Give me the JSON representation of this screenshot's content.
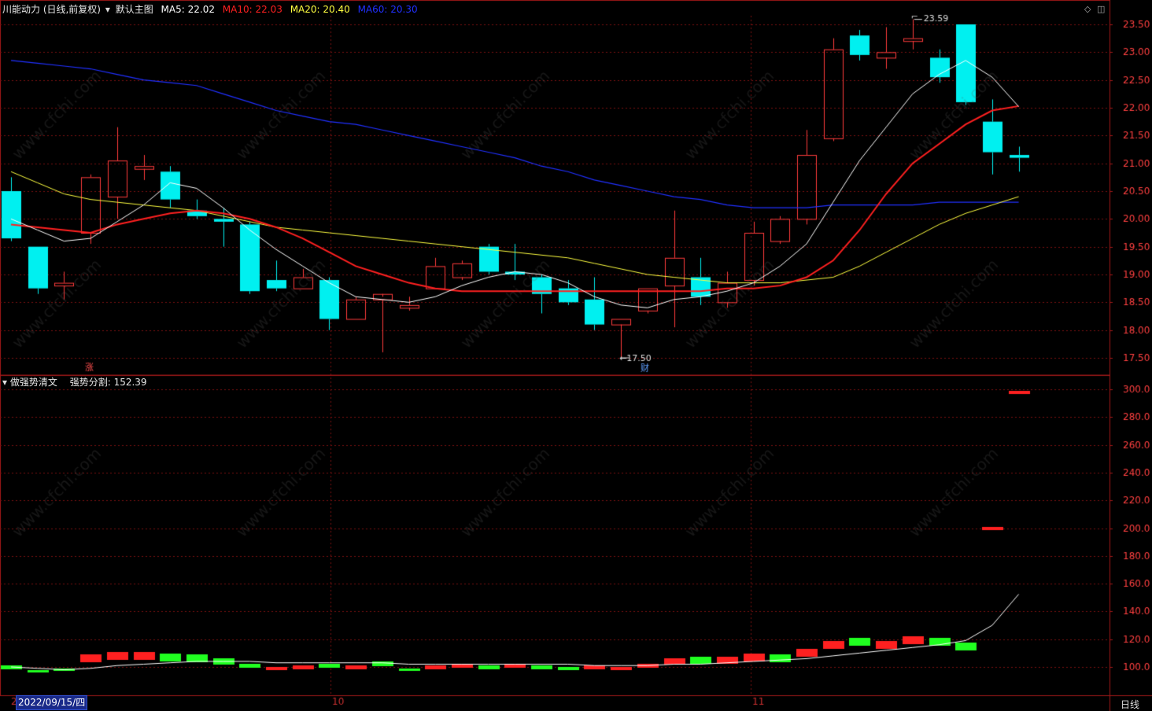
{
  "header": {
    "stock_title": "川能动力 (日线,前复权)",
    "main_chart_label": "默认主图",
    "ma5": {
      "label": "MA5:",
      "value": "22.02",
      "color": "#ffffff"
    },
    "ma10": {
      "label": "MA10:",
      "value": "22.03",
      "color": "#ff2020"
    },
    "ma20": {
      "label": "MA20:",
      "value": "20.40",
      "color": "#ffff40"
    },
    "ma60": {
      "label": "MA60:",
      "value": "20.30",
      "color": "#2030ff"
    }
  },
  "sub_header": {
    "indicator_name": "做强势清文",
    "metric_label": "强势分割:",
    "metric_value": "152.39"
  },
  "annotations": {
    "high_label": "23.59",
    "low_label": "17.50",
    "marker_zhang": "涨",
    "marker_cai": "财"
  },
  "x_axis": {
    "selected_date": "2022/09/15/四",
    "year_hint": "2",
    "month_10": "10",
    "month_11": "11",
    "period": "日线"
  },
  "colors": {
    "up": "#ff3b3b",
    "down": "#00f0f0",
    "grid": "#7a1010",
    "border": "#a01818",
    "axis_text": "#ff4040",
    "vol_up": "#ff2020",
    "vol_down": "#20ff20"
  },
  "chart_data": [
    {
      "type": "candlestick",
      "y_ticks": [
        "23.50",
        "23.00",
        "22.50",
        "22.00",
        "21.50",
        "21.00",
        "20.50",
        "20.00",
        "19.50",
        "19.00",
        "18.50",
        "18.00",
        "17.50"
      ],
      "ylim": [
        17.3,
        23.7
      ],
      "candles": [
        {
          "o": 20.5,
          "h": 20.75,
          "l": 19.6,
          "c": 19.65
        },
        {
          "o": 19.5,
          "h": 19.5,
          "l": 18.65,
          "c": 18.75
        },
        {
          "o": 18.8,
          "h": 19.05,
          "l": 18.55,
          "c": 18.85
        },
        {
          "o": 19.75,
          "h": 20.8,
          "l": 19.55,
          "c": 20.75
        },
        {
          "o": 20.4,
          "h": 21.65,
          "l": 20.0,
          "c": 21.05
        },
        {
          "o": 20.9,
          "h": 21.15,
          "l": 20.7,
          "c": 20.95
        },
        {
          "o": 20.85,
          "h": 20.95,
          "l": 20.2,
          "c": 20.35
        },
        {
          "o": 20.15,
          "h": 20.35,
          "l": 20.0,
          "c": 20.05
        },
        {
          "o": 20.0,
          "h": 20.2,
          "l": 19.5,
          "c": 19.95
        },
        {
          "o": 19.9,
          "h": 19.95,
          "l": 18.65,
          "c": 18.7
        },
        {
          "o": 18.9,
          "h": 19.25,
          "l": 18.7,
          "c": 18.75
        },
        {
          "o": 18.75,
          "h": 19.1,
          "l": 18.75,
          "c": 18.95
        },
        {
          "o": 18.9,
          "h": 18.95,
          "l": 18.0,
          "c": 18.2
        },
        {
          "o": 18.2,
          "h": 18.6,
          "l": 18.2,
          "c": 18.55
        },
        {
          "o": 18.55,
          "h": 18.6,
          "l": 17.6,
          "c": 18.65
        },
        {
          "o": 18.4,
          "h": 18.6,
          "l": 18.35,
          "c": 18.45
        },
        {
          "o": 18.75,
          "h": 19.3,
          "l": 18.75,
          "c": 19.15
        },
        {
          "o": 18.95,
          "h": 19.25,
          "l": 18.9,
          "c": 19.2
        },
        {
          "o": 19.5,
          "h": 19.55,
          "l": 19.0,
          "c": 19.05
        },
        {
          "o": 19.05,
          "h": 19.55,
          "l": 18.9,
          "c": 19.0
        },
        {
          "o": 18.95,
          "h": 19.0,
          "l": 18.3,
          "c": 18.65
        },
        {
          "o": 18.75,
          "h": 18.9,
          "l": 18.45,
          "c": 18.5
        },
        {
          "o": 18.55,
          "h": 18.95,
          "l": 18.0,
          "c": 18.1
        },
        {
          "o": 18.1,
          "h": 18.2,
          "l": 17.5,
          "c": 18.2
        },
        {
          "o": 18.35,
          "h": 18.75,
          "l": 18.3,
          "c": 18.75
        },
        {
          "o": 18.8,
          "h": 20.15,
          "l": 18.05,
          "c": 19.3
        },
        {
          "o": 18.95,
          "h": 19.3,
          "l": 18.45,
          "c": 18.6
        },
        {
          "o": 18.5,
          "h": 19.05,
          "l": 18.4,
          "c": 18.85
        },
        {
          "o": 18.9,
          "h": 19.95,
          "l": 18.8,
          "c": 19.75
        },
        {
          "o": 19.6,
          "h": 20.05,
          "l": 19.55,
          "c": 20.0
        },
        {
          "o": 20.0,
          "h": 21.6,
          "l": 19.9,
          "c": 21.15
        },
        {
          "o": 21.45,
          "h": 23.25,
          "l": 21.4,
          "c": 23.05
        },
        {
          "o": 23.3,
          "h": 23.4,
          "l": 22.85,
          "c": 22.95
        },
        {
          "o": 22.9,
          "h": 23.45,
          "l": 22.7,
          "c": 23.0
        },
        {
          "o": 23.2,
          "h": 23.59,
          "l": 23.05,
          "c": 23.25
        },
        {
          "o": 22.9,
          "h": 23.05,
          "l": 22.45,
          "c": 22.55
        },
        {
          "o": 23.5,
          "h": 23.5,
          "l": 22.05,
          "c": 22.1
        },
        {
          "o": 21.75,
          "h": 22.15,
          "l": 20.8,
          "c": 21.2
        },
        {
          "o": 21.15,
          "h": 21.3,
          "l": 20.85,
          "c": 21.1
        }
      ],
      "ma5": [
        20.0,
        19.8,
        19.6,
        19.65,
        19.95,
        20.25,
        20.65,
        20.55,
        20.2,
        19.8,
        19.45,
        19.15,
        18.85,
        18.6,
        18.55,
        18.5,
        18.6,
        18.8,
        18.95,
        19.05,
        19.0,
        18.85,
        18.6,
        18.45,
        18.4,
        18.55,
        18.6,
        18.7,
        18.85,
        19.15,
        19.55,
        20.3,
        21.05,
        21.65,
        22.25,
        22.6,
        22.85,
        22.55,
        22.02
      ],
      "ma10": [
        19.9,
        19.85,
        19.8,
        19.75,
        19.9,
        20.0,
        20.1,
        20.15,
        20.1,
        20.0,
        19.85,
        19.65,
        19.4,
        19.15,
        19.0,
        18.85,
        18.75,
        18.7,
        18.7,
        18.7,
        18.7,
        18.7,
        18.7,
        18.7,
        18.7,
        18.7,
        18.7,
        18.75,
        18.75,
        18.8,
        18.95,
        19.25,
        19.8,
        20.45,
        21.0,
        21.35,
        21.7,
        21.95,
        22.03
      ],
      "ma20": [
        20.85,
        20.65,
        20.45,
        20.35,
        20.3,
        20.25,
        20.2,
        20.15,
        20.05,
        19.95,
        19.85,
        19.8,
        19.75,
        19.7,
        19.65,
        19.6,
        19.55,
        19.5,
        19.45,
        19.4,
        19.35,
        19.3,
        19.2,
        19.1,
        19.0,
        18.95,
        18.9,
        18.85,
        18.85,
        18.85,
        18.9,
        18.95,
        19.15,
        19.4,
        19.65,
        19.9,
        20.1,
        20.25,
        20.4
      ],
      "ma60": [
        22.85,
        22.8,
        22.75,
        22.7,
        22.6,
        22.5,
        22.45,
        22.4,
        22.25,
        22.1,
        21.95,
        21.85,
        21.75,
        21.7,
        21.6,
        21.5,
        21.4,
        21.3,
        21.2,
        21.1,
        20.95,
        20.85,
        20.7,
        20.6,
        20.5,
        20.4,
        20.35,
        20.25,
        20.2,
        20.2,
        20.2,
        20.25,
        20.25,
        20.25,
        20.25,
        20.3,
        20.3,
        20.3,
        20.3
      ]
    },
    {
      "type": "bar",
      "name": "强势分割",
      "y_ticks": [
        "300.0",
        "280.0",
        "260.0",
        "240.0",
        "220.0",
        "200.0",
        "180.0",
        "160.0",
        "140.0",
        "120.0",
        "100.0"
      ],
      "ylim": [
        80,
        308
      ],
      "bars": [
        {
          "v": 100,
          "up": false
        },
        {
          "v": 97,
          "up": false
        },
        {
          "v": 98,
          "up": false
        },
        {
          "v": 106,
          "up": true
        },
        {
          "v": 108,
          "up": true
        },
        {
          "v": 108,
          "up": true
        },
        {
          "v": 107,
          "up": false
        },
        {
          "v": 106,
          "up": false
        },
        {
          "v": 104,
          "up": false
        },
        {
          "v": 101,
          "up": false
        },
        {
          "v": 99,
          "up": true
        },
        {
          "v": 100,
          "up": true
        },
        {
          "v": 101,
          "up": false
        },
        {
          "v": 100,
          "up": true
        },
        {
          "v": 102,
          "up": false
        },
        {
          "v": 98,
          "up": false
        },
        {
          "v": 100,
          "up": true
        },
        {
          "v": 101,
          "up": true
        },
        {
          "v": 100,
          "up": false
        },
        {
          "v": 101,
          "up": true
        },
        {
          "v": 100,
          "up": false
        },
        {
          "v": 99,
          "up": false
        },
        {
          "v": 100,
          "up": true
        },
        {
          "v": 99,
          "up": true
        },
        {
          "v": 101,
          "up": true
        },
        {
          "v": 104,
          "up": true
        },
        {
          "v": 105,
          "up": false
        },
        {
          "v": 105,
          "up": true
        },
        {
          "v": 107,
          "up": true
        },
        {
          "v": 106,
          "up": false
        },
        {
          "v": 110,
          "up": true
        },
        {
          "v": 116,
          "up": true
        },
        {
          "v": 118,
          "up": false
        },
        {
          "v": 116,
          "up": true
        },
        {
          "v": 119,
          "up": true
        },
        {
          "v": 118,
          "up": false
        },
        {
          "v": 115,
          "up": false
        },
        {
          "v": 200,
          "up": true
        },
        {
          "v": 298,
          "up": true
        }
      ],
      "line": [
        100,
        99,
        98,
        99,
        101,
        102,
        103,
        104,
        104,
        104,
        103,
        103,
        103,
        103,
        103,
        102,
        102,
        102,
        102,
        102,
        102,
        102,
        101,
        101,
        101,
        102,
        102,
        103,
        104,
        105,
        106,
        108,
        110,
        112,
        114,
        116,
        119,
        130,
        152.39
      ]
    }
  ]
}
